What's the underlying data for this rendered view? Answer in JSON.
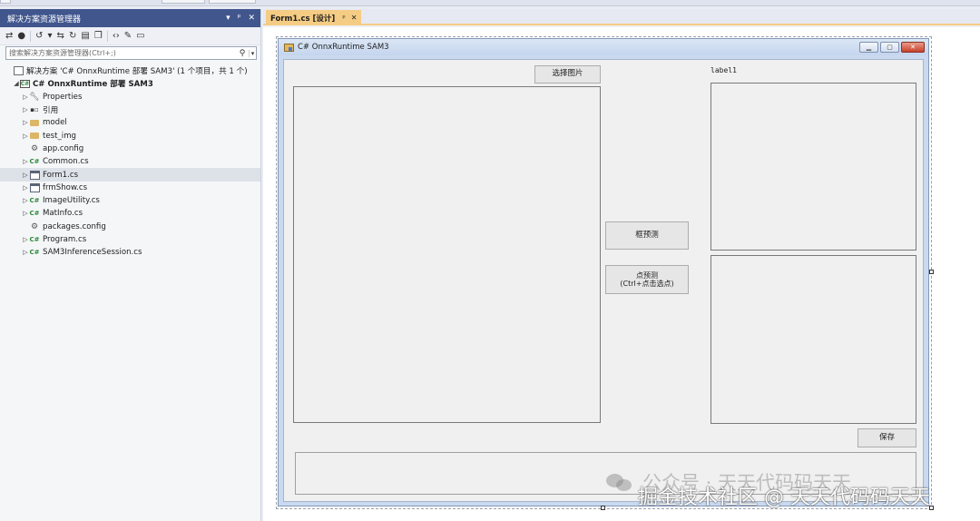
{
  "solution_explorer": {
    "title": "解决方案资源管理器",
    "title_controls": [
      "▾",
      "ᵖ",
      "✕"
    ],
    "search_placeholder": "搜索解决方案资源管理器(Ctrl+;)",
    "tree": [
      {
        "label": "解决方案 'C# OnnxRuntime 部署 SAM3' (1 个项目，共 1 个)",
        "icon": "solution-icon"
      },
      {
        "label": "C# OnnxRuntime 部署 SAM3",
        "icon": "csharp-project-icon"
      },
      {
        "label": "Properties",
        "icon": "wrench-icon"
      },
      {
        "label": "引用",
        "icon": "references-icon"
      },
      {
        "label": "model",
        "icon": "folder-icon"
      },
      {
        "label": "test_img",
        "icon": "folder-icon"
      },
      {
        "label": "app.config",
        "icon": "config-file-icon"
      },
      {
        "label": "Common.cs",
        "icon": "csharp-file-icon"
      },
      {
        "label": "Form1.cs",
        "icon": "form-file-icon",
        "selected": true
      },
      {
        "label": "frmShow.cs",
        "icon": "form-file-icon"
      },
      {
        "label": "ImageUtility.cs",
        "icon": "csharp-file-icon"
      },
      {
        "label": "MatInfo.cs",
        "icon": "csharp-file-icon"
      },
      {
        "label": "packages.config",
        "icon": "config-file-icon"
      },
      {
        "label": "Program.cs",
        "icon": "csharp-file-icon"
      },
      {
        "label": "SAM3InferenceSession.cs",
        "icon": "csharp-file-icon"
      }
    ]
  },
  "editor": {
    "tab_label": "Form1.cs [设计]",
    "tab_pin": "ᵖ",
    "tab_close": "✕"
  },
  "form": {
    "title": "C# OnnxRuntime SAM3",
    "select_image_button": "选择图片",
    "box_predict_button": "框预测",
    "point_predict_button": "点预测\n(Ctrl+点击选点)",
    "label1": "label1",
    "save_button": "保存"
  },
  "watermark": {
    "line1": "公众号 · 天天代码码天天",
    "line2": "掘金技术社区 @ 天天代码码天天"
  },
  "colors": {
    "solution_explorer_title_bg": "#40568d",
    "active_tab_bg": "#f5cc84",
    "form_title_gradient": "#c4d5ee",
    "form_client_bg": "#f0f0f0"
  }
}
